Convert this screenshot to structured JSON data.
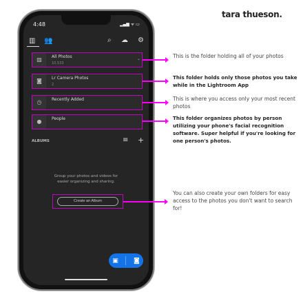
{
  "brand": "tara thueson.",
  "status": {
    "time": "4:48",
    "icons": "▂▄▆ ᯤ ▭"
  },
  "rows": [
    {
      "title": "All Photos",
      "count": "10,533",
      "icon": "image-icon"
    },
    {
      "title": "Lr Camera Photos",
      "count": "2",
      "icon": "camera-icon"
    },
    {
      "title": "Recently Added",
      "count": "",
      "icon": "clock-icon"
    },
    {
      "title": "People",
      "count": "",
      "icon": "person-icon"
    }
  ],
  "albums_label": "ALBUMS",
  "empty_msg_1": "Group your photos and videos for",
  "empty_msg_2": "easier organizing and sharing.",
  "create_label": "Create an Album",
  "notes": [
    "This is the folder holding all of your photos",
    "This folder holds only those photos you take while in the Lightroom App",
    "This is where you access only your most recent photos",
    "This folder organizes photos by person utilizing your phone's facial recognition software. Super helpful if you're looking for one person's photos.",
    "You can also create your own folders for easy access to the photos you don't want to search for!"
  ]
}
